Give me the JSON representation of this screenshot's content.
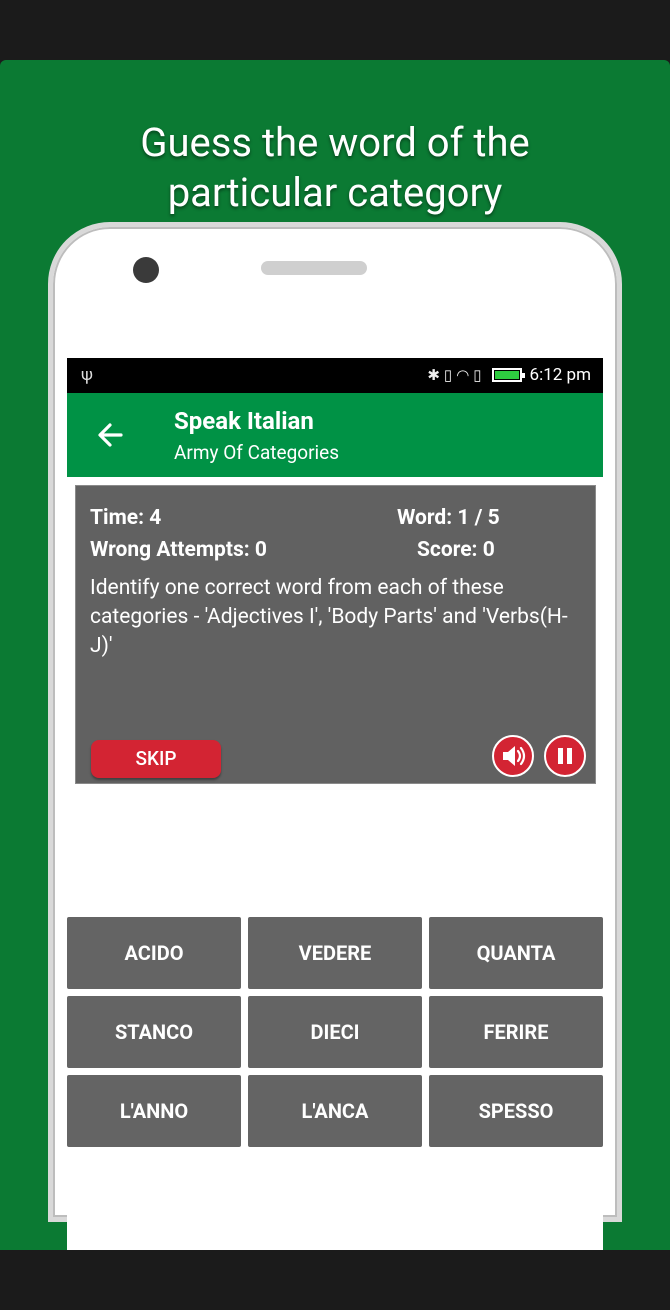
{
  "promo": {
    "headline_line1": "Guess the word of the",
    "headline_line2": "particular category"
  },
  "statusbar": {
    "usb_icon": "ψ",
    "time": "6:12 pm"
  },
  "appbar": {
    "title": "Speak Italian",
    "subtitle": "Army Of Categories"
  },
  "stats": {
    "time": "Time: 4",
    "word": "Word: 1 / 5",
    "wrong_attempts": "Wrong Attempts: 0",
    "score": "Score: 0"
  },
  "instruction": "Identify one correct word from each of these categories - 'Adjectives I', 'Body Parts' and 'Verbs(H-J)'",
  "skip_label": "SKIP",
  "words": [
    "ACIDO",
    "VEDERE",
    "QUANTA",
    "STANCO",
    "DIECI",
    "FERIRE",
    "L'ANNO",
    "L'ANCA",
    "SPESSO"
  ],
  "colors": {
    "promo_bg": "#0b7a33",
    "appbar": "#009245",
    "panel": "#616161",
    "accent_red": "#d32433",
    "word_button": "#646464"
  }
}
